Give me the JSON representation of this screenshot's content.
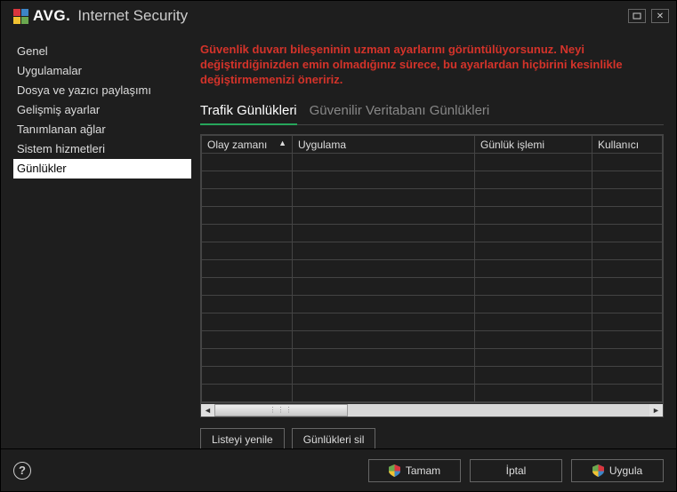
{
  "brand": {
    "name": "AVG",
    "product": "Internet Security"
  },
  "sidebar": {
    "items": [
      "Genel",
      "Uygulamalar",
      "Dosya ve yazıcı paylaşımı",
      "Gelişmiş ayarlar",
      "Tanımlanan ağlar",
      "Sistem hizmetleri",
      "Günlükler"
    ],
    "selected_index": 6
  },
  "warning": "Güvenlik duvarı bileşeninin uzman ayarlarını görüntülüyorsunuz. Neyi değiştirdiğinizden emin olmadığınız sürece, bu ayarlardan hiçbirini kesinlikle değiştirmemenizi öneririz.",
  "tabs": [
    {
      "label": "Trafik Günlükleri",
      "active": true
    },
    {
      "label": "Güvenilir Veritabanı Günlükleri",
      "active": false
    }
  ],
  "table": {
    "columns": [
      "Olay zamanı",
      "Uygulama",
      "Günlük işlemi",
      "Kullanıcı"
    ],
    "sort_col": 0,
    "rows": 14
  },
  "table_buttons": {
    "refresh": "Listeyi yenile",
    "delete": "Günlükleri sil"
  },
  "footer": {
    "ok": "Tamam",
    "cancel": "İptal",
    "apply": "Uygula"
  }
}
